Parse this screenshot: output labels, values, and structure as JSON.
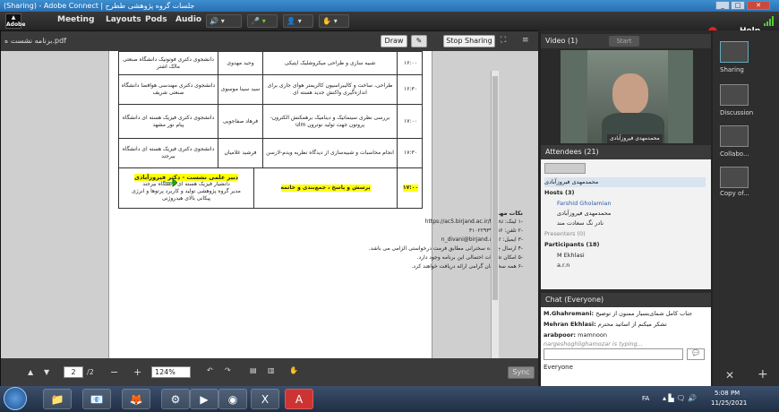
{
  "window": {
    "title": "(Sharing) - Adobe Connect | جلسات گروه پژوهشی ططرح"
  },
  "menubar": {
    "items": [
      "Meeting",
      "Layouts",
      "Pods",
      "Audio"
    ],
    "help": "Help"
  },
  "share_pod": {
    "filename": "برنامه نشست‌ ه.pdf",
    "draw_label": "Draw",
    "stop_sharing_label": "Stop Sharing",
    "page_current": "2",
    "page_total": "/2",
    "zoom": "124%",
    "sync_label": "Sync"
  },
  "document": {
    "rows": [
      {
        "time": "۱۶:۰۰",
        "title": "شبیه سازی و طراحی میکرو‌شلیک اپتیکی",
        "speaker": "وحید مهدوی",
        "affil": "دانشجوی دکتری فوتونیک دانشگاه صنعتی مالک اشتر"
      },
      {
        "time": "۱۶:۳۰",
        "title": "طراحی، ساخت و کالیبراسیون کالریمتر هوای جاری برای اندازه‌گیری واکنش جدید هسته ای",
        "speaker": "سید سینا موسوی",
        "affil": "دانشجوی دکتری مهندسی هوافضا دانشگاه صنعتی شریف"
      },
      {
        "time": "۱۷:۰۰",
        "title": "بررسی نظری سینماتیک و دینامیک برهمکنش الکترون-پروتون جهت تولید نوترون ulm",
        "speaker": "فرهاد صفاجویی",
        "affil": "دانشجوی دکتری فیزیک هسته ای دانشگاه پیام نور مشهد"
      },
      {
        "time": "۱۷:۳۰",
        "title": "انجام محاسبات و شبیه‌سازی از دیدگاه نظریه ویدم-لارسن",
        "speaker": "فرشید غلامیان",
        "affil": "دانشجوی دکتری فیزیک هسته ای دانشگاه بیرجند"
      }
    ],
    "secretary_title": "دبیر علمی نشست - دکتر فیروزآبادی",
    "secretary_lines": [
      "دانشیار فیزیک هسته ای دانشگاه بیرجند",
      "مدیر گروه پژوهشی تولید و کاربرد پرتوها و انرژی",
      "پیکانی بالای هیدروژنی"
    ],
    "qa_label": "پرسش و پاسخ ، جمع‌بندی و خاتمه",
    "qa_time": "۱۷:۰۰",
    "notes_title": "نکات مهم:",
    "notes": [
      "-۱   لینک: https://ac5.birjand.ac.ir/tolou",
      "-۲   تلفن: ۰۵۶-۳۱۰۲۲۹۳۹",
      "-۳   ایمیل: n_divani@birjand.ac.ir",
      "-۴   ارسال چکیده سخنرانی مطابق فرمت درخواستی الزامی می باشد.",
      "-۵   امکان تغییرات احتمالی این برنامه وجود دارد.",
      "-۶   همه سخنرانان گرامی ارائه دریافت خواهند کرد."
    ]
  },
  "video_pod": {
    "title": "Video",
    "count": "(1)",
    "start_label": "Start",
    "caption": "محمدمهدی فیروزآبادی"
  },
  "attendees_pod": {
    "title": "Attendees",
    "count": "(21)",
    "current_user": "محمدمهدی فیروزآبادی",
    "hosts_label": "Hosts (3)",
    "hosts": [
      "Farshid Gholamian",
      "محمدمهدی فیروزآبادی",
      "نادر نگ سعادت مند"
    ],
    "presenters_label": "Presenters (0)",
    "participants_label": "Participants (18)",
    "participants": [
      "M Ekhlasi",
      "a.r.n"
    ]
  },
  "chat_pod": {
    "title": "Chat",
    "scope": "(Everyone)",
    "messages": [
      {
        "from": "M.Ghahremani:",
        "text": "جناب کامل شمای‌بسیار ممنون از توضیح"
      },
      {
        "from": "Mehran Ekhlasi:",
        "text": "تشکر میکنم از اساتید محترم"
      },
      {
        "from": "arabpoor:",
        "text": "mamnoon"
      }
    ],
    "typing": "nargeshoghlighamozar is typing...",
    "target": "Everyone"
  },
  "sidebar": {
    "items": [
      "Sharing",
      "Discussion",
      "Collabo...",
      "Copy of..."
    ]
  },
  "taskbar": {
    "lang": "FA",
    "time": "5:08 PM",
    "date": "11/25/2021"
  }
}
